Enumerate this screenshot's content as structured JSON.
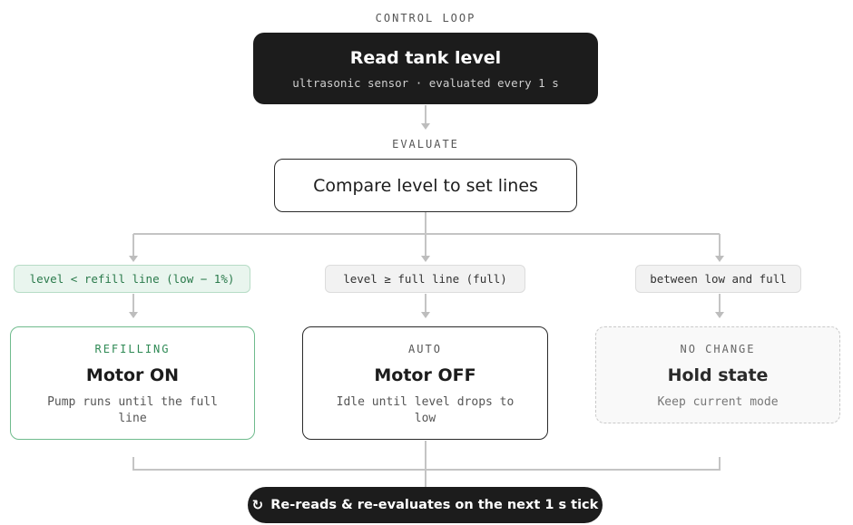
{
  "header": {
    "section_label": "CONTROL LOOP",
    "read_title": "Read tank level",
    "read_sub": "ultrasonic sensor · evaluated every 1 s"
  },
  "evaluate": {
    "section_label": "EVALUATE",
    "title": "Compare level to set lines"
  },
  "branches": [
    {
      "condition": "level < refill line (low − 1%)",
      "tag": "REFILLING",
      "name": "Motor ON",
      "desc": "Pump runs until the full line",
      "accent": "#2f8a55"
    },
    {
      "condition": "level ≥ full line (full)",
      "tag": "AUTO",
      "name": "Motor OFF",
      "desc": "Idle until level drops to low",
      "accent": "#1c1c1c"
    },
    {
      "condition": "between low and full",
      "tag": "NO CHANGE",
      "name": "Hold state",
      "desc": "Keep current mode",
      "accent": "#9a9a9a"
    }
  ],
  "footer": {
    "icon": "refresh-icon",
    "label": "Re-reads & re-evaluates on the next 1 s tick"
  }
}
